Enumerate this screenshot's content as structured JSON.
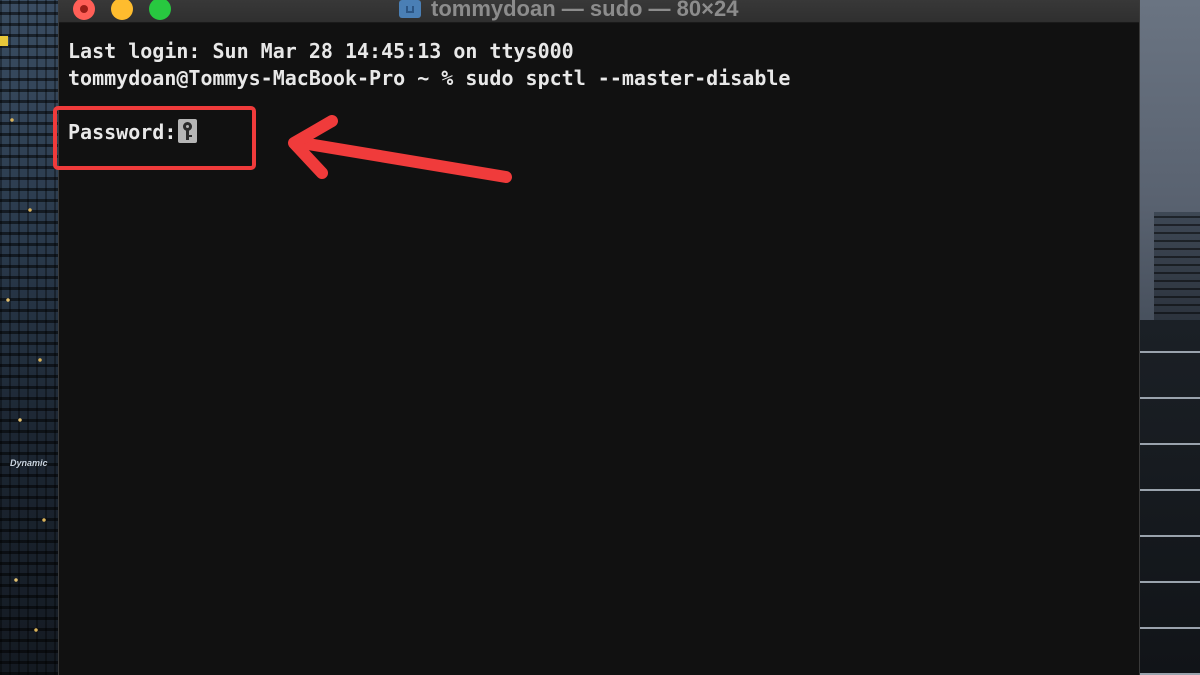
{
  "window": {
    "title": "tommydoan — sudo — 80×24"
  },
  "terminal": {
    "lines": [
      "Last login: Sun Mar 28 14:45:13 on ttys000",
      "tommydoan@Tommys-MacBook-Pro ~ % sudo spctl --master-disable",
      "",
      "Password:"
    ]
  },
  "colors": {
    "close": "#ff5f57",
    "minimize": "#febc2e",
    "maximize": "#28c840",
    "annotation": "#f03b3b",
    "terminal_bg": "#111111",
    "terminal_text": "#e8e8e8"
  },
  "icons": {
    "folder": "folder-icon",
    "password_cursor": "key-icon",
    "annotation_arrow": "arrow-left-icon"
  }
}
